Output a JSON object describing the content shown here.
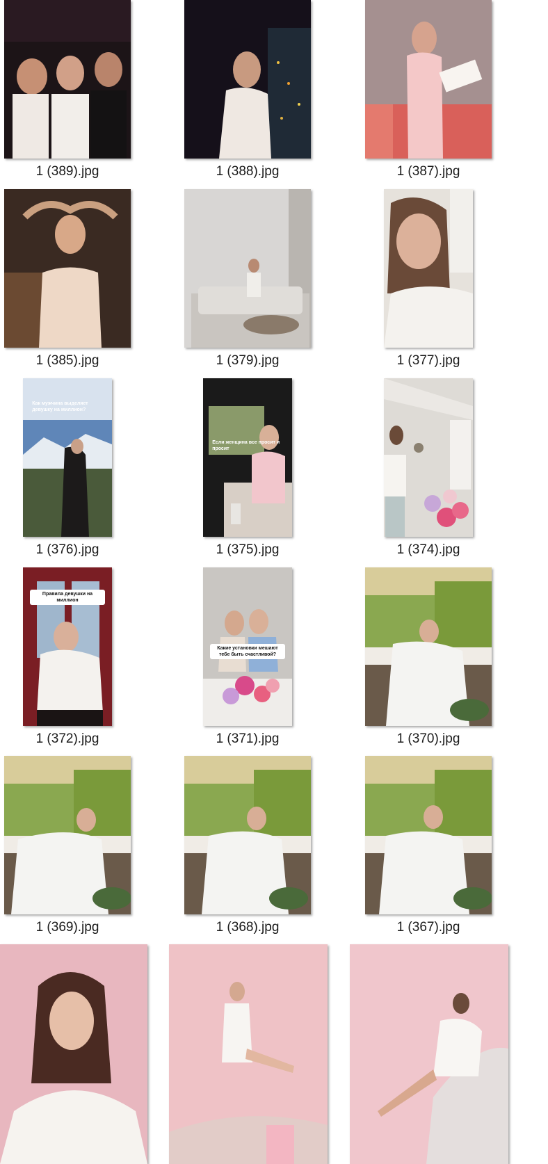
{
  "files": [
    {
      "name": "1 (389).jpg"
    },
    {
      "name": "1 (388).jpg"
    },
    {
      "name": "1 (387).jpg"
    },
    {
      "name": "1 (385).jpg"
    },
    {
      "name": "1 (379).jpg"
    },
    {
      "name": "1 (377).jpg"
    },
    {
      "name": "1 (376).jpg",
      "overlay": "Как мужчина выделяет девушку на миллион?"
    },
    {
      "name": "1 (375).jpg",
      "overlay": "Если женщина все просит и просит"
    },
    {
      "name": "1 (374).jpg"
    },
    {
      "name": "1 (372).jpg",
      "overlay": "Правила девушки на миллион"
    },
    {
      "name": "1 (371).jpg",
      "overlay": "Какие установки мешают тебе быть счастливой?"
    },
    {
      "name": "1 (370).jpg"
    },
    {
      "name": "1 (369).jpg"
    },
    {
      "name": "1 (368).jpg"
    },
    {
      "name": "1 (367).jpg"
    },
    {
      "name": ""
    },
    {
      "name": ""
    },
    {
      "name": ""
    }
  ],
  "colors": {
    "background": "#ffffff",
    "caption_text": "#1a1a1a"
  }
}
